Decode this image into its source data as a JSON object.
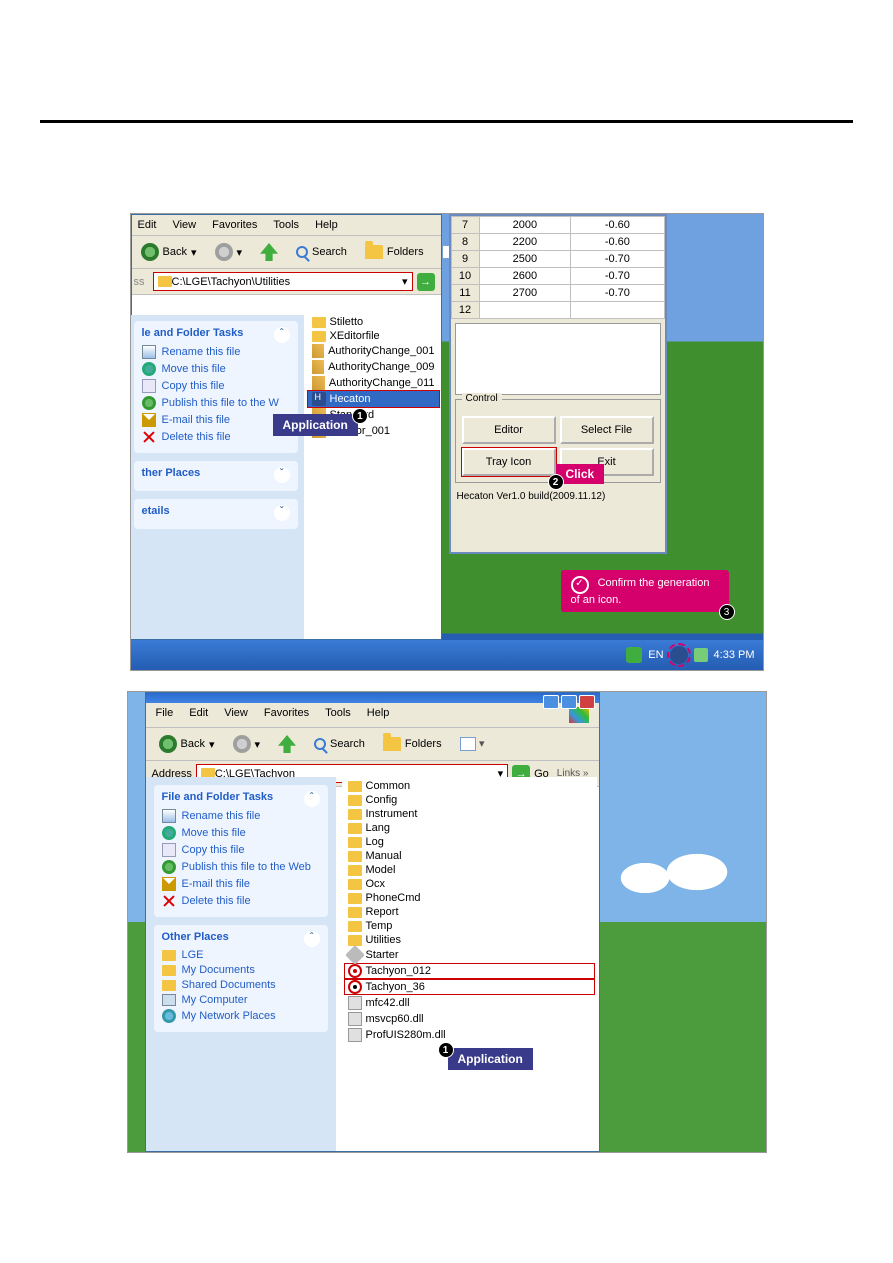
{
  "shot1": {
    "menubar": [
      "Edit",
      "View",
      "Favorites",
      "Tools",
      "Help"
    ],
    "toolbar": {
      "back": "Back",
      "search": "Search",
      "folders": "Folders"
    },
    "address": {
      "prefix": "ss",
      "path": "C:\\LGE\\Tachyon\\Utilities"
    },
    "tasks": {
      "title": "le and Folder Tasks",
      "items": [
        "Rename this file",
        "Move this file",
        "Copy this file",
        "Publish this file to the W",
        "E-mail this file",
        "Delete this file"
      ]
    },
    "other_places_title": "ther Places",
    "details_title": "etails",
    "files": [
      "Stiletto",
      "XEditorfile",
      "AuthorityChange_001",
      "AuthorityChange_009",
      "AuthorityChange_011",
      "Hecaton",
      "Standard",
      "XEditor_001"
    ],
    "callout_app": "Application",
    "hecaton": {
      "rows": [
        {
          "n": "7",
          "a": "2000",
          "b": "-0.60"
        },
        {
          "n": "8",
          "a": "2200",
          "b": "-0.60"
        },
        {
          "n": "9",
          "a": "2500",
          "b": "-0.70"
        },
        {
          "n": "10",
          "a": "2600",
          "b": "-0.70"
        },
        {
          "n": "11",
          "a": "2700",
          "b": "-0.70"
        },
        {
          "n": "12",
          "a": "",
          "b": ""
        }
      ],
      "group": "Control",
      "buttons": {
        "editor": "Editor",
        "select": "Select File",
        "tray": "Tray Icon",
        "exit": "Exit"
      },
      "version": "Hecaton Ver1.0 build(2009.11.12)"
    },
    "click_label": "Click",
    "tip_text": "Confirm the generation of an icon.",
    "tray": {
      "lang": "EN",
      "time": "4:33 PM"
    }
  },
  "shot2": {
    "menubar": [
      "File",
      "Edit",
      "View",
      "Favorites",
      "Tools",
      "Help"
    ],
    "toolbar": {
      "back": "Back",
      "search": "Search",
      "folders": "Folders"
    },
    "address": {
      "label": "Address",
      "path": "C:\\LGE\\Tachyon",
      "go": "Go",
      "links": "Links"
    },
    "tasks": {
      "title": "File and Folder Tasks",
      "items": [
        "Rename this file",
        "Move this file",
        "Copy this file",
        "Publish this file to the Web",
        "E-mail this file",
        "Delete this file"
      ]
    },
    "other": {
      "title": "Other Places",
      "items": [
        "LGE",
        "My Documents",
        "Shared Documents",
        "My Computer",
        "My Network Places"
      ]
    },
    "files": [
      "Common",
      "Config",
      "Instrument",
      "Lang",
      "Log",
      "Manual",
      "Model",
      "Ocx",
      "PhoneCmd",
      "Report",
      "Temp",
      "Utilities",
      "Starter",
      "Tachyon_012",
      "Tachyon_36",
      "mfc42.dll",
      "msvcp60.dll",
      "ProfUIS280m.dll"
    ],
    "callout_app": "Application"
  }
}
